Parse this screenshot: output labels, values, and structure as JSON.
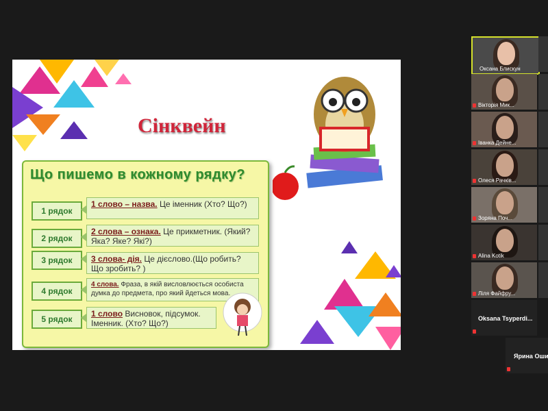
{
  "slide": {
    "title": "Сінквейн",
    "heading": "Що пишемо в кожному рядку?",
    "rows": [
      {
        "label": "1  рядок",
        "term": "1 слово – назва.",
        "text": " Це іменник (Хто? Що?)"
      },
      {
        "label": "2 рядок",
        "term": "2 слова – ознака.",
        "text": " Це прикметник. (Який? Яка? Яке? Які?)"
      },
      {
        "label": "3  рядок",
        "term": "3 слова- дія.",
        "text": " Це дієслово.(Що робить? Що зробить? )"
      },
      {
        "label": "4 рядок",
        "term": "4 слова.",
        "text": " Фраза, в якій висловлюється особиста думка до предмета, про який йдеться мова."
      },
      {
        "label": "5  рядок",
        "term": "1 слово",
        "text": " Висновок, підсумок. Іменник. (Хто? Що?)"
      }
    ]
  },
  "participants": [
    {
      "name": "Оксана Блискун",
      "active": true
    },
    {
      "name": "Вікторія Мик...",
      "active": false
    },
    {
      "name": "Іванка Дейне...",
      "active": false
    },
    {
      "name": "Олеся Рачків...",
      "active": false
    },
    {
      "name": "Зоряна Поч...",
      "active": false
    },
    {
      "name": "Alina Kotik",
      "active": false
    },
    {
      "name": "Ліля Файфру...",
      "active": false
    },
    {
      "name": "Oksana  Tsyperdi...",
      "active": false
    },
    {
      "name": "Ярина Оши",
      "active": false
    }
  ],
  "colors": {
    "accent_active": "#d6e22b",
    "mic_muted": "#e33333"
  }
}
